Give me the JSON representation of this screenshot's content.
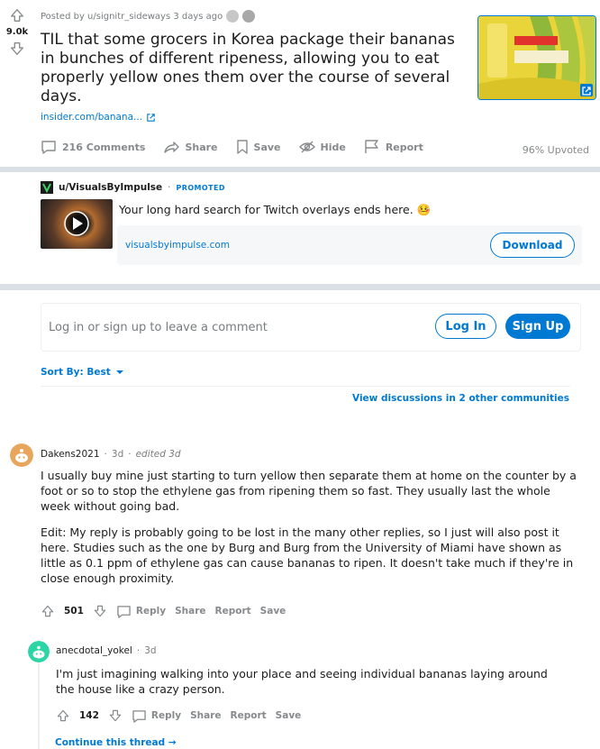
{
  "post": {
    "score": "9.0k",
    "posted_by": "Posted by u/signitr_sideways 3 days ago",
    "title": "TIL that some grocers in Korea package their bananas in bunches of different ripeness, allowing you to eat properly yellow ones them over the course of several days.",
    "link_text": "insider.com/banana...",
    "actions": {
      "comments": "216 Comments",
      "share": "Share",
      "save": "Save",
      "hide": "Hide",
      "report": "Report"
    },
    "upvoted": "96% Upvoted"
  },
  "ad": {
    "user": "u/VisualsByImpulse",
    "promoted": "PROMOTED",
    "text": "Your long hard search for Twitch overlays ends here. 🤒",
    "url": "visualsbyimpulse.com",
    "button": "Download"
  },
  "login": {
    "prompt": "Log in or sign up to leave a comment",
    "login_button": "Log In",
    "signup_button": "Sign Up"
  },
  "sort": {
    "label": "Sort By: Best"
  },
  "other_communities": "View discussions in 2 other communities",
  "comments": [
    {
      "author": "Dakens2021",
      "time": "3d",
      "edited": "edited 3d",
      "paragraphs": [
        "I usually buy mine just starting to turn yellow then separate them at home on the counter by a foot or so to stop the ethylene gas from ripening them so fast. They usually last the whole week without going bad.",
        "Edit: My reply is probably going to be lost in the many other replies, so I just will also post it here. Studies such as the one by Burg and Burg from the University of Miami have shown as little as 0.1 ppm of ethylene gas can cause bananas to ripen. It doesn't take much if they're in close enough proximity."
      ],
      "score": "501",
      "reply": "Reply",
      "share": "Share",
      "report": "Report",
      "save": "Save"
    },
    {
      "author": "anecdotal_yokel",
      "time": "3d",
      "paragraphs": [
        "I'm just imagining walking into your place and seeing individual bananas laying around the house like a crazy person."
      ],
      "score": "142",
      "reply": "Reply",
      "share": "Share",
      "report": "Report",
      "save": "Save"
    }
  ],
  "continue_thread": "Continue this thread",
  "colors": {
    "accent": "#0079d3",
    "background": "#dae0e6",
    "muted": "#878a8c"
  }
}
